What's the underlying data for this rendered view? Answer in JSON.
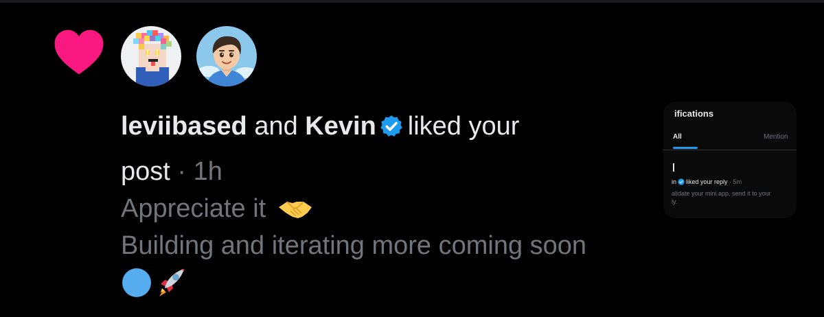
{
  "notification": {
    "icon": "heart-icon",
    "icon_color": "#f91880",
    "avatars": [
      {
        "name": "pixel-art-avatar"
      },
      {
        "name": "cartoon-boy-avatar"
      }
    ],
    "user1": "leviibased",
    "connector": "and",
    "user2": "Kevin",
    "verified_color": "#1d9bf0",
    "action_text": "liked your",
    "action_text_2": "post",
    "separator": "·",
    "time": "1h",
    "post_lines": [
      "Appreciate it",
      "Building and iterating  more coming soon"
    ],
    "emojis": [
      "handshake-emoji",
      "blue-circle-emoji",
      "rocket-emoji"
    ]
  },
  "mini_screenshot": {
    "title": "ifications",
    "tab_all": "All",
    "tab_mentions": "Mention",
    "notif_name": "in",
    "notif_action": "liked your reply",
    "notif_time": "· 5m",
    "notif_body_1": "alidate your mini app, send it to your",
    "notif_body_2": "ly."
  }
}
